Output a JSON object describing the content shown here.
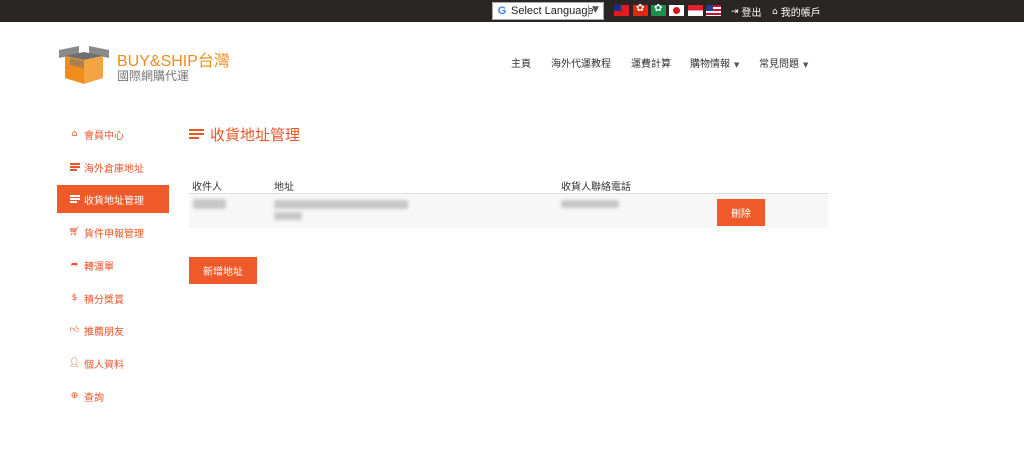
{
  "topbar": {
    "language_label": "Select Language",
    "flags": [
      "taiwan-flag",
      "hong-kong-flag",
      "macau-flag",
      "japan-flag",
      "singapore-flag",
      "usa-flag"
    ],
    "logout_label": "登出",
    "account_label": "我的帳戶"
  },
  "header": {
    "brand_name": "BUY&SHIP台灣",
    "brand_sub": "國際網購代運",
    "nav": [
      {
        "label": "主頁"
      },
      {
        "label": "海外代運教程"
      },
      {
        "label": "運費計算"
      },
      {
        "label": "購物情報"
      },
      {
        "label": "常見問題"
      }
    ]
  },
  "sidebar": {
    "items": [
      {
        "label": "會員中心",
        "icon": "home-icon"
      },
      {
        "label": "海外倉庫地址",
        "icon": "list-icon"
      },
      {
        "label": "收貨地址管理",
        "icon": "list-icon",
        "active": true
      },
      {
        "label": "貨件申報管理",
        "icon": "cart-icon"
      },
      {
        "label": "轉運單",
        "icon": "share-icon"
      },
      {
        "label": "積分獎賞",
        "icon": "dollar-icon"
      },
      {
        "label": "推薦朋友",
        "icon": "thumbs-up-icon"
      },
      {
        "label": "個人資料",
        "icon": "user-icon"
      },
      {
        "label": "查詢",
        "icon": "lifebuoy-icon"
      }
    ]
  },
  "main": {
    "title": "收貨地址管理",
    "table": {
      "headers": [
        "收件人",
        "地址",
        "收貨人聯絡電話"
      ],
      "delete_label": "刪除"
    },
    "add_button_label": "新增地址"
  },
  "colors": {
    "accent": "#ef5a2b",
    "brand": "#f08c1e",
    "topbar": "#2b2626"
  }
}
